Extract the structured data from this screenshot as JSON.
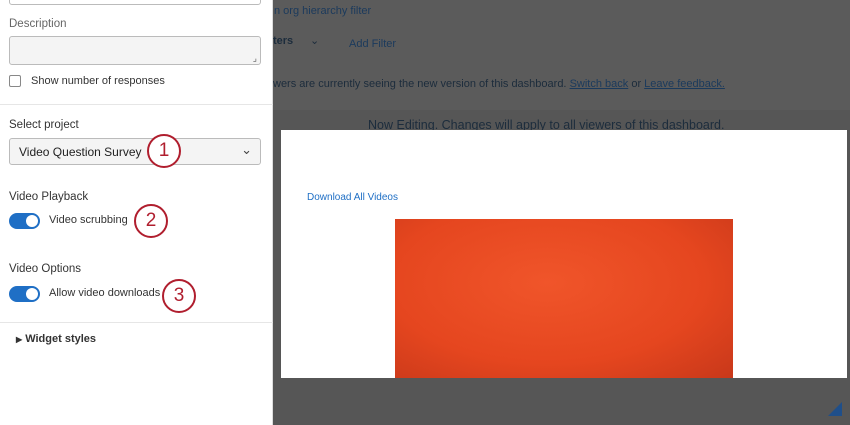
{
  "panel": {
    "description_label": "Description",
    "show_responses_label": "Show number of responses",
    "select_project_label": "Select project",
    "project_value": "Video Question Survey",
    "video_playback_label": "Video Playback",
    "video_scrubbing_label": "Video scrubbing",
    "video_scrubbing_on": true,
    "video_options_label": "Video Options",
    "allow_downloads_label": "Allow video downloads",
    "allow_downloads_on": true,
    "widget_styles_label": "Widget styles"
  },
  "callouts": [
    "1",
    "2",
    "3"
  ],
  "background": {
    "org_filter": "n org hierarchy filter",
    "filters": "ters",
    "add_filter": "Add Filter",
    "notice": "wers are currently seeing the new version of this dashboard.",
    "switch_back": "Switch back",
    "or": "or",
    "leave_feedback": "Leave feedback.",
    "editing": "Now Editing. Changes will apply to all viewers of this dashboard."
  },
  "modal": {
    "download_all": "Download All Videos"
  }
}
